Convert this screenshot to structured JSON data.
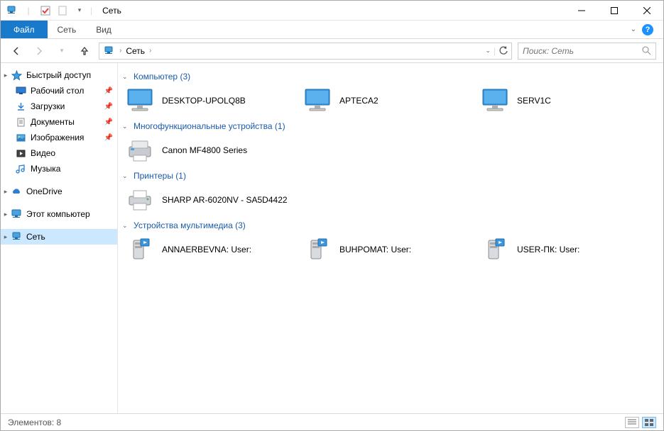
{
  "window": {
    "title": "Сеть"
  },
  "ribbon": {
    "file": "Файл",
    "tabs": [
      "Сеть",
      "Вид"
    ]
  },
  "breadcrumb": {
    "root": "Сеть"
  },
  "search": {
    "placeholder": "Поиск: Сеть"
  },
  "sidebar": {
    "quick_access": "Быстрый доступ",
    "quick_items": [
      {
        "label": "Рабочий стол",
        "icon": "desktop"
      },
      {
        "label": "Загрузки",
        "icon": "downloads"
      },
      {
        "label": "Документы",
        "icon": "documents"
      },
      {
        "label": "Изображения",
        "icon": "pictures"
      },
      {
        "label": "Видео",
        "icon": "videos"
      },
      {
        "label": "Музыка",
        "icon": "music"
      }
    ],
    "onedrive": "OneDrive",
    "this_pc": "Этот компьютер",
    "network": "Сеть"
  },
  "groups": [
    {
      "title": "Компьютер (3)",
      "type": "computer",
      "items": [
        "DESKTOP-UPOLQ8B",
        "APTECA2",
        "SERV1C"
      ]
    },
    {
      "title": "Многофункциональные устройства (1)",
      "type": "mfd",
      "items": [
        "Canon MF4800 Series"
      ]
    },
    {
      "title": "Принтеры (1)",
      "type": "printer",
      "items": [
        "SHARP AR-6020NV - SA5D4422"
      ]
    },
    {
      "title": "Устройства мультимедиа (3)",
      "type": "media",
      "items": [
        "ANNAERBEVNA: User:",
        "BUHPOMAT: User:",
        "USER-ПК: User:"
      ]
    }
  ],
  "statusbar": {
    "items": "Элементов: 8"
  }
}
